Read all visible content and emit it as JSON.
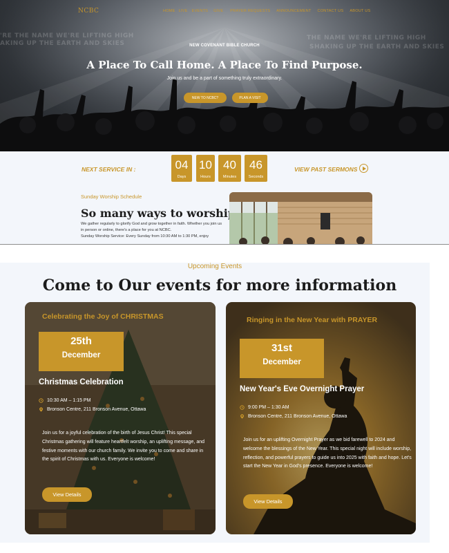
{
  "nav": {
    "logo": "NCBC",
    "links": [
      "HOME",
      "LIVE",
      "EVENTS",
      "GIVE",
      "PRAYER REQUESTS",
      "ANNOUNCEMENT",
      "CONTACT US",
      "ABOUT US"
    ]
  },
  "hero": {
    "kicker": "NEW COVENANT BIBLE CHURCH",
    "title": "A Place To Call Home. A Place To Find Purpose.",
    "subtitle": "Join us and be a part of something truly extraordinary.",
    "btn_new": "NEW TO NCBC?",
    "btn_visit": "PLAN A VISIT",
    "backdrop_text": [
      "'RE THE NAME WE'RE LIFTING HIGH",
      "AKING UP THE EARTH AND SKIES",
      "THE NAME WE'RE LIFTING HIGH",
      "SHAKING UP THE EARTH AND SKIES"
    ]
  },
  "service": {
    "next_label": "NEXT SERVICE IN :",
    "countdown": [
      {
        "num": "04",
        "label": "Days"
      },
      {
        "num": "10",
        "label": "Hours"
      },
      {
        "num": "40",
        "label": "Minutes"
      },
      {
        "num": "46",
        "label": "Seconds"
      }
    ],
    "past_sermons": "VIEW PAST SERMONS"
  },
  "worship": {
    "kicker": "Sunday Worship Schedule",
    "title": "So many ways to worship",
    "body": "We gather regularly to glorify God and grow together in faith. Whether you join us in person or online, there's a place for you at NCBC.",
    "schedule": "Sunday Worship Service: Every Sunday from 10:30 AM to 1:30 PM, enjoy"
  },
  "events": {
    "kicker": "Upcoming Events",
    "title": "Come to Our events for more information",
    "cards": [
      {
        "heading": "Celebrating the Joy of CHRISTMAS",
        "day": "25th",
        "month": "December",
        "name": "Christmas Celebration",
        "time": "10:30 AM – 1:15 PM",
        "location": "Bronson Centre, 211 Bronson Avenue, Ottawa",
        "desc": "Join us for a joyful celebration of the birth of Jesus Christ! This special Christmas gathering will feature heartfelt worship, an uplifting message, and festive moments with our church family. We invite you to come and share in the spirit of Christmas with us. Everyone is welcome!",
        "button": "View Details"
      },
      {
        "heading": "Ringing in the New Year with PRAYER",
        "day": "31st",
        "month": "December",
        "name": "New Year's Eve Overnight Prayer",
        "time": "9:00 PM – 1:30 AM",
        "location": "Bronson Centre, 211 Bronson Avenue, Ottawa",
        "desc": "Join us for an uplifting Overnight Prayer as we bid farewell to 2024 and welcome the blessings of the New Year. This special night will include worship, reflection, and powerful prayers to guide us into 2025 with faith and hope. Let's start the New Year in God's presence. Everyone is welcome!",
        "button": "View Details"
      }
    ]
  },
  "colors": {
    "accent": "#c8962a",
    "dark_text": "#1d1d1d",
    "light_bg": "#f3f6fb"
  }
}
